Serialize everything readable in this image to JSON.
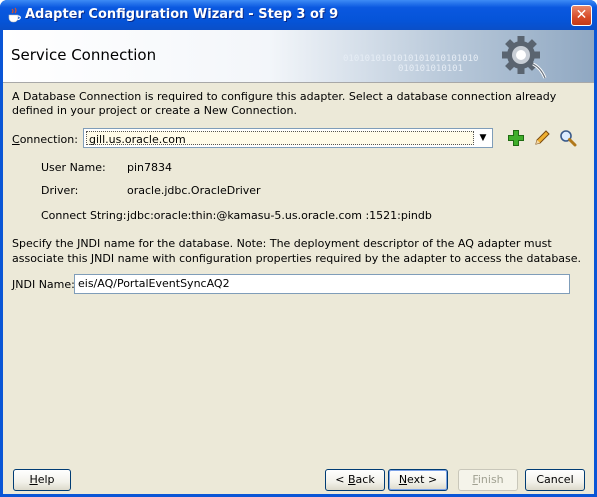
{
  "window": {
    "title": "Adapter Configuration Wizard - Step 3 of 9",
    "close_glyph": "✕"
  },
  "header": {
    "title": "Service Connection",
    "binary_line1": "0101010101010101010101010",
    "binary_line2": "010101010101",
    "graphic_icon": "gear-plug-icon"
  },
  "description": "A Database Connection is required to configure this adapter. Select a database connection already defined in your project or create a New Connection.",
  "connection": {
    "label_mnemonic": "C",
    "label_rest": "onnection:",
    "selected": "gill.us.oracle.com",
    "add_icon": "plus-icon",
    "edit_icon": "pencil-icon",
    "browse_icon": "magnifier-icon"
  },
  "details": {
    "user_name_label": "User Name:",
    "user_name": "pin7834",
    "driver_label": "Driver:",
    "driver": "oracle.jdbc.OracleDriver",
    "connect_string_label": "Connect String:",
    "connect_string": "jdbc:oracle:thin:@kamasu-5.us.oracle.com :1521:pindb"
  },
  "jndi": {
    "description": "Specify the JNDI name for the database.  Note: The deployment descriptor of the AQ adapter must associate this JNDI name with configuration properties required by the adapter to access the database.",
    "label_mnemonic": "J",
    "label_rest": "NDI Name:",
    "value": "eis/AQ/PortalEventSyncAQ2"
  },
  "buttons": {
    "help_mnemonic": "H",
    "help_rest": "elp",
    "back_prefix": "< ",
    "back_mnemonic": "B",
    "back_rest": "ack",
    "next_mnemonic": "N",
    "next_rest": "ext >",
    "finish_mnemonic": "F",
    "finish_rest": "inish",
    "cancel": "Cancel"
  }
}
